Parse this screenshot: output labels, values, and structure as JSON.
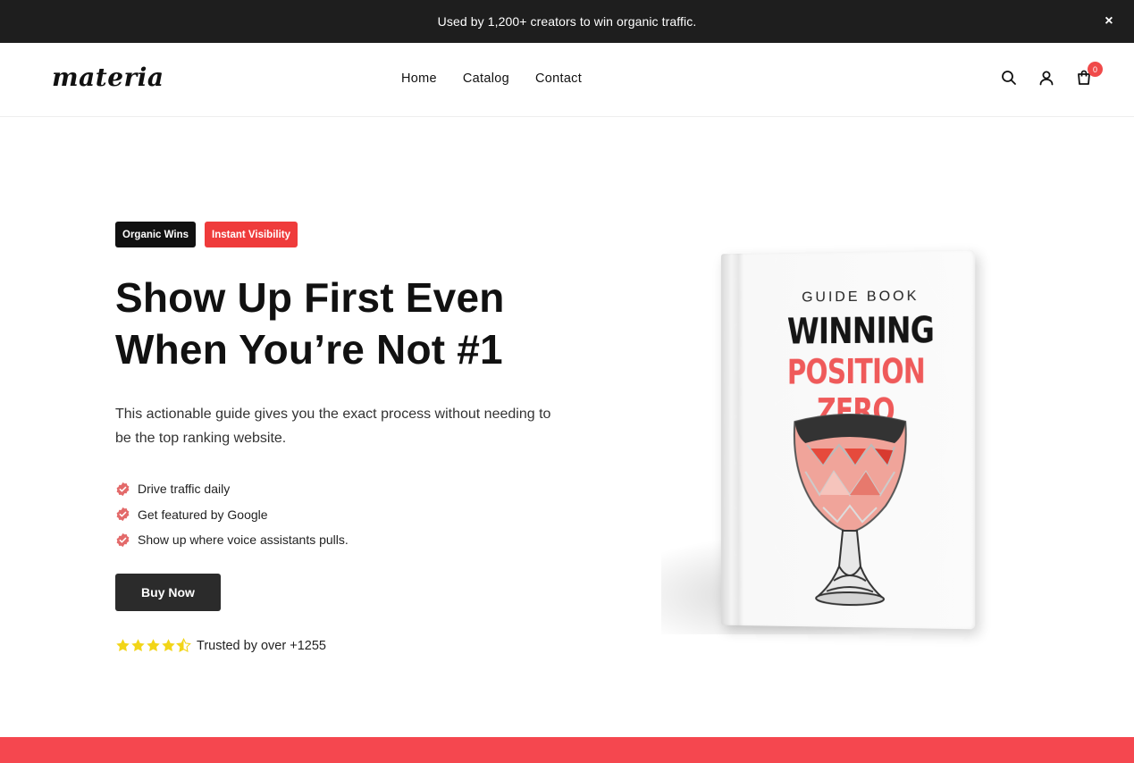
{
  "announcement": {
    "text": "Used by 1,200+ creators to win organic traffic.",
    "close_icon": "×"
  },
  "header": {
    "logo": "materia",
    "nav": [
      "Home",
      "Catalog",
      "Contact"
    ],
    "cart_count": "0",
    "icons": [
      "search-icon",
      "account-icon",
      "cart-icon"
    ]
  },
  "hero": {
    "badges": [
      "Organic Wins",
      "Instant Visibility"
    ],
    "headline_line1": "Show Up First Even",
    "headline_line2": "When You’re Not #1",
    "description": "This actionable guide gives you the exact process without needing to be the top ranking website.",
    "features": [
      "Drive traffic daily",
      "Get featured by Google",
      "Show up where voice assistants pulls."
    ],
    "cta": "Buy Now",
    "rating": 4.5,
    "trust_text": "Trusted by over +1255"
  },
  "book": {
    "kicker": "GUIDE BOOK",
    "title_line1": "WINNING",
    "title_line2": "POSITION ZERO"
  },
  "colors": {
    "announcement_bg": "#1e1e1e",
    "accent_red": "#ef3b3b",
    "bottom_bar": "#f5474f",
    "star": "#f2d518",
    "button_dark": "#2b2b2b"
  }
}
